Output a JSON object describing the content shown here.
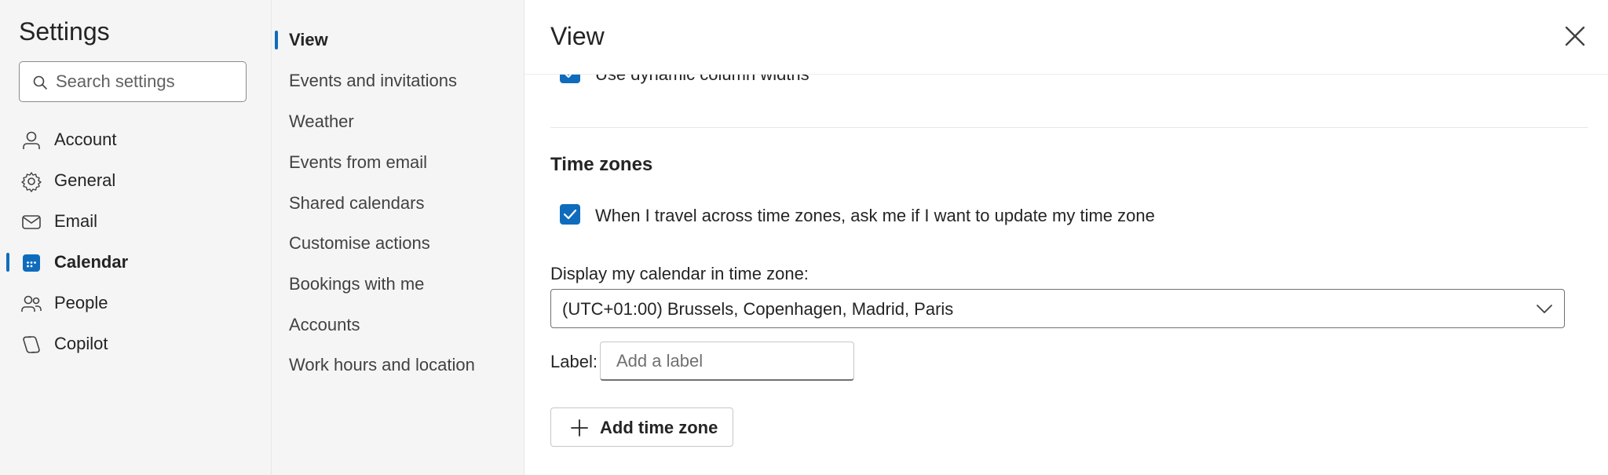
{
  "nav": {
    "title": "Settings",
    "search": {
      "placeholder": "Search settings",
      "icon": "search-icon"
    },
    "items": [
      {
        "label": "Account",
        "icon": "person-icon"
      },
      {
        "label": "General",
        "icon": "gear-icon"
      },
      {
        "label": "Email",
        "icon": "mail-icon"
      },
      {
        "label": "Calendar",
        "icon": "calendar-icon",
        "active": true
      },
      {
        "label": "People",
        "icon": "people-icon"
      },
      {
        "label": "Copilot",
        "icon": "copilot-icon"
      }
    ]
  },
  "subnav": {
    "items": [
      {
        "label": "View",
        "active": true
      },
      {
        "label": "Events and invitations"
      },
      {
        "label": "Weather"
      },
      {
        "label": "Events from email"
      },
      {
        "label": "Shared calendars"
      },
      {
        "label": "Customise actions"
      },
      {
        "label": "Bookings with me"
      },
      {
        "label": "Accounts"
      },
      {
        "label": "Work hours and location"
      }
    ]
  },
  "main": {
    "title": "View",
    "close_icon": "close-icon",
    "cutoff_option": {
      "label": "Use dynamic column widths",
      "checked": true
    },
    "time_zones": {
      "title": "Time zones",
      "ask_option": {
        "label": "When I travel across time zones, ask me if I want to update my time zone",
        "checked": true
      },
      "display_label": "Display my calendar in time zone:",
      "selected_zone": "(UTC+01:00) Brussels, Copenhagen, Madrid, Paris",
      "label_caption": "Label:",
      "label_placeholder": "Add a label",
      "add_button": "Add time zone"
    }
  },
  "colors": {
    "accent": "#0f6cbd",
    "nav_bg": "#f5f5f5",
    "text": "#242424"
  }
}
